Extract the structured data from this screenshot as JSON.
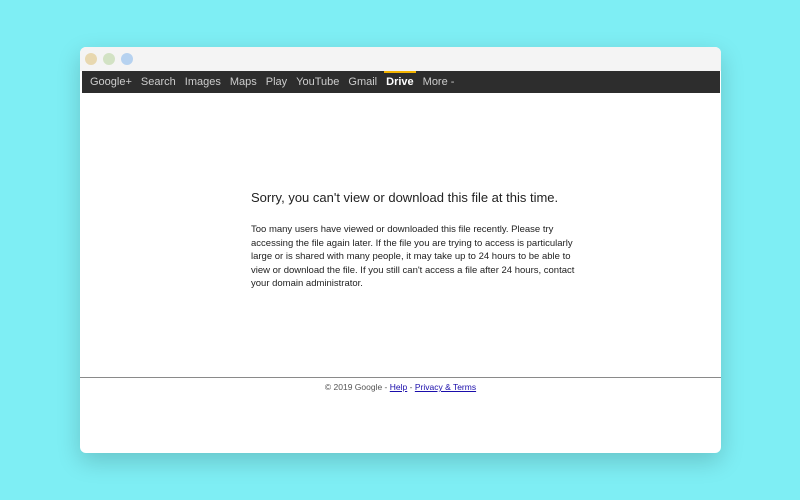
{
  "nav": {
    "items": [
      "Google+",
      "Search",
      "Images",
      "Maps",
      "Play",
      "YouTube",
      "Gmail",
      "Drive",
      "More -"
    ],
    "active": "Drive"
  },
  "main": {
    "heading": "Sorry, you can't view or download this file at this time.",
    "message": "Too many users have viewed or downloaded this file recently. Please try accessing the file again later. If the file you are trying to access is particularly large or is shared with many people, it may take up to 24 hours to be able to view or download the file. If you still can't access a file after 24 hours, contact your domain administrator."
  },
  "footer": {
    "copyright": "© 2019 Google -",
    "help": "Help",
    "separator": "-",
    "privacy": "Privacy & Terms"
  },
  "colors": {
    "background": "#7eeef4",
    "navbar": "#2d2d2d",
    "active_accent": "#f4b400",
    "link": "#1a0dab"
  }
}
